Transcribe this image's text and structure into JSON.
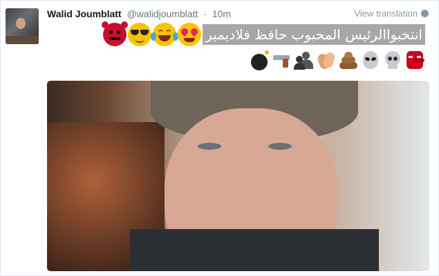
{
  "tweet": {
    "author_name": "Walid Joumblatt",
    "author_handle": "@walidjoumblatt",
    "separator": "·",
    "time": "10m",
    "translate_label": "View translation",
    "text": "انتخبواالرئيس المحبوب حافظ فلاديمير"
  },
  "emojis_line1": [
    "devil-emoji",
    "sunglasses-face-emoji",
    "tears-of-joy-emoji",
    "heart-eyes-emoji"
  ],
  "emojis_line2": [
    "bomb-emoji",
    "pistol-emoji",
    "shadow-people-emoji",
    "clapping-hands-emoji",
    "poop-emoji",
    "alien-emoji",
    "skull-emoji",
    "tengu-mask-emoji"
  ]
}
